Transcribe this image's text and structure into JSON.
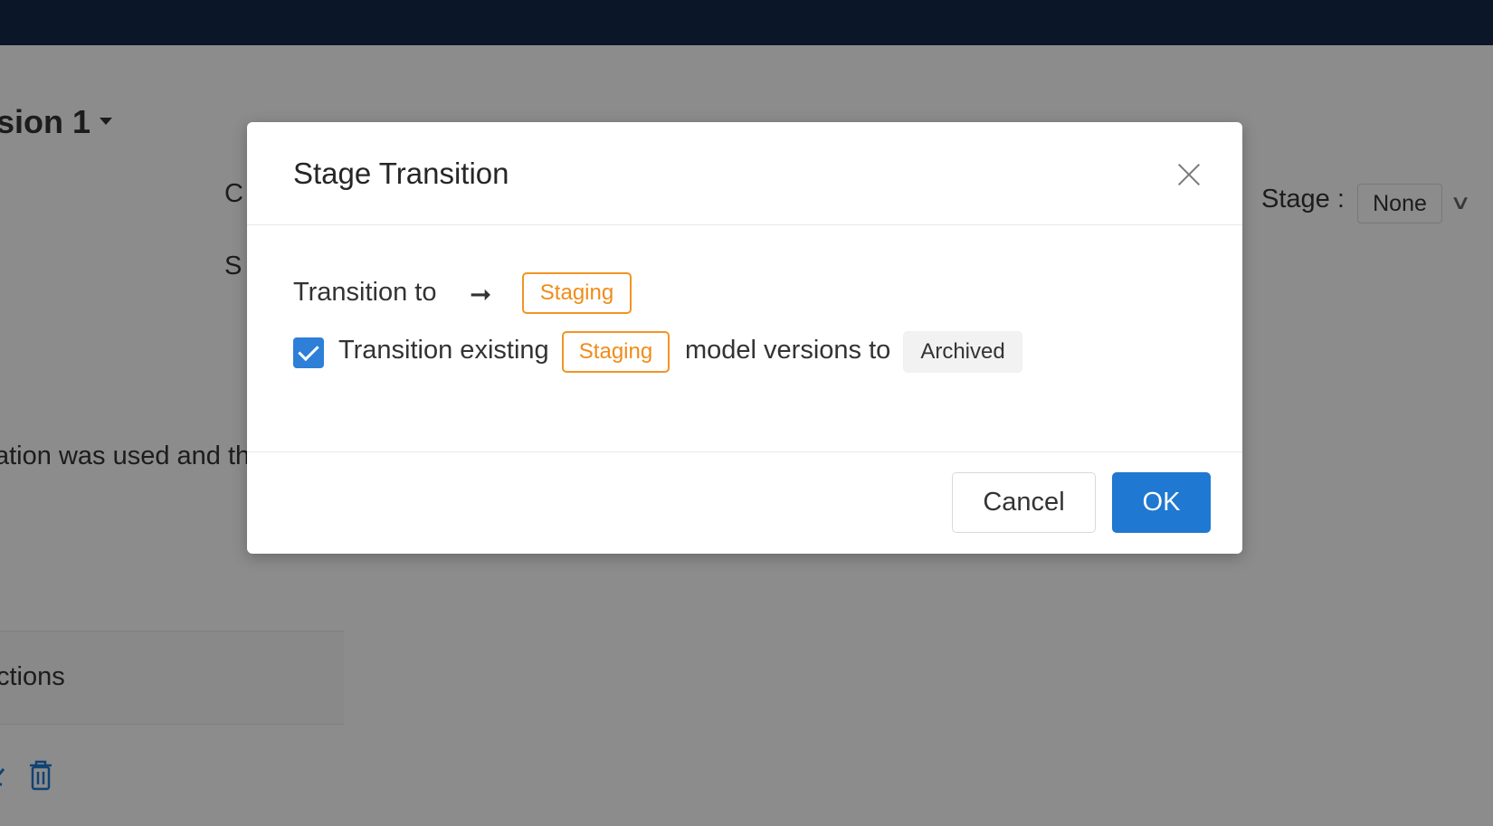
{
  "background": {
    "title": "sion 1",
    "truncated_label_c": "C",
    "truncated_label_s": "S",
    "stage_label": "Stage :",
    "stage_value": "None",
    "description_fragment": "ation was used and th",
    "table_header_fragment": "ctions"
  },
  "modal": {
    "title": "Stage Transition",
    "transition_to_label": "Transition to",
    "target_stage": "Staging",
    "checkbox_checked": true,
    "existing_text_before": "Transition existing",
    "existing_stage": "Staging",
    "existing_text_after": "model versions to",
    "archive_stage": "Archived",
    "cancel_label": "Cancel",
    "ok_label": "OK"
  },
  "colors": {
    "topbar": "#0b1628",
    "primary": "#1f78d1",
    "staging_tag": "#f08c1a",
    "checkbox": "#2e7fd8"
  },
  "icons": {
    "caret": "caret-down-icon",
    "arrow": "arrow-right-icon",
    "close": "close-icon",
    "check": "check-icon",
    "edit": "edit-icon",
    "trash": "trash-icon"
  }
}
